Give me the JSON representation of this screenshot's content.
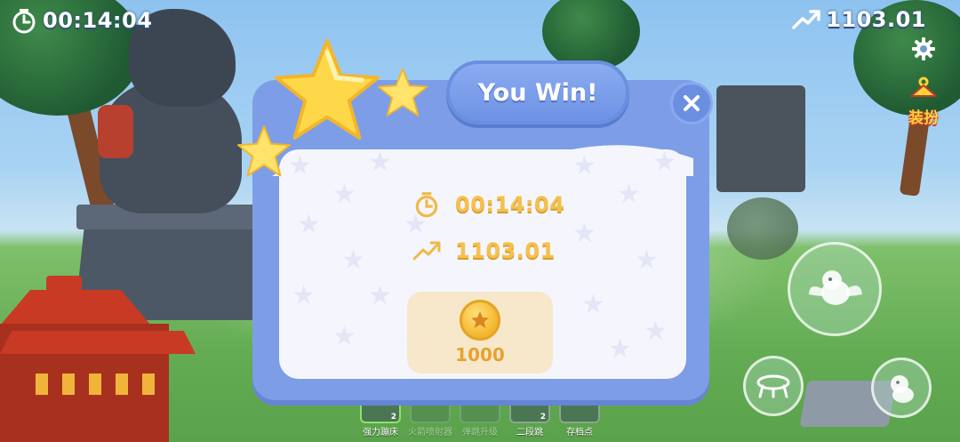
{
  "hud": {
    "timer": "00:14:04",
    "score": "1103.01",
    "dress_up_label": "装扮"
  },
  "dialog": {
    "title": "You Win!",
    "time": "00:14:04",
    "score": "1103.01",
    "reward": "1000"
  },
  "skills": [
    {
      "label": "强力蹦床",
      "count": "2",
      "active": true
    },
    {
      "label": "火箭喷射器",
      "count": "",
      "active": false
    },
    {
      "label": "弹跳升级",
      "count": "",
      "active": false
    },
    {
      "label": "二段跳",
      "count": "2",
      "active": false
    },
    {
      "label": "存档点",
      "count": "",
      "active": false
    }
  ],
  "colors": {
    "dialog_frame": "#7d9ee6",
    "stat_gold": "#f4c14f",
    "title_blue": "#6b8fe0"
  }
}
